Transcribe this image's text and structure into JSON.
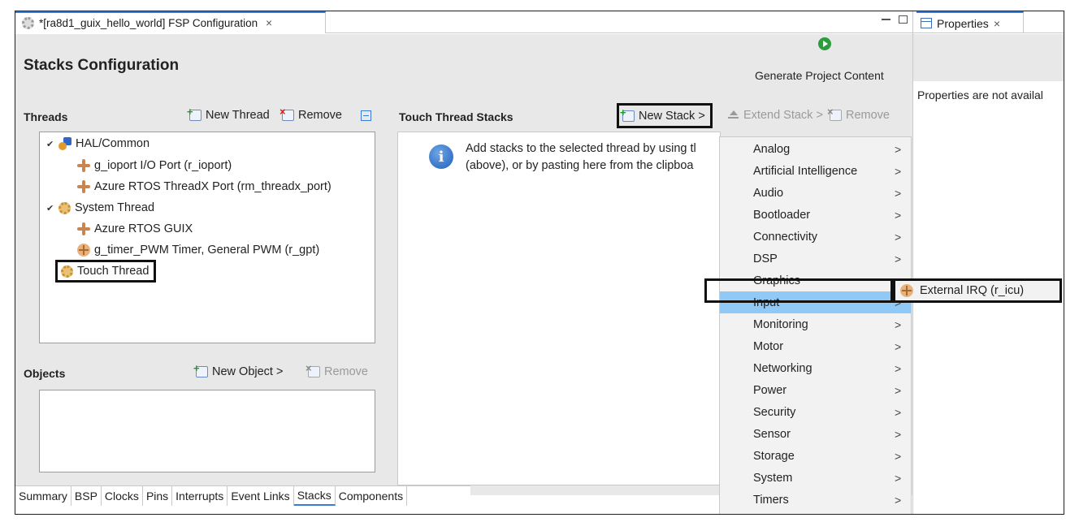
{
  "editor_tab": {
    "title": "*[ra8d1_guix_hello_world] FSP Configuration",
    "close": "×"
  },
  "stacks_header": {
    "title": "Stacks Configuration",
    "generate_label": "Generate Project Content"
  },
  "threads": {
    "title": "Threads",
    "new_thread": "New Thread",
    "remove": "Remove",
    "tree": [
      {
        "label": "HAL/Common",
        "icon": "hal-icon"
      },
      {
        "label": "g_ioport I/O Port (r_ioport)",
        "icon": "module-icon"
      },
      {
        "label": "Azure RTOS ThreadX Port (rm_threadx_port)",
        "icon": "module-icon"
      },
      {
        "label": "System Thread",
        "icon": "gear-icon"
      },
      {
        "label": "Azure RTOS GUIX",
        "icon": "module-icon"
      },
      {
        "label": "g_timer_PWM Timer, General PWM (r_gpt)",
        "icon": "module-icon"
      },
      {
        "label": "Touch Thread",
        "icon": "gear-icon"
      }
    ]
  },
  "objects": {
    "title": "Objects",
    "new_object": "New Object >",
    "remove": "Remove"
  },
  "touch_stacks": {
    "title": "Touch Thread Stacks",
    "new_stack": "New Stack >",
    "extend_stack": "Extend Stack >",
    "remove": "Remove",
    "info_line1": "Add stacks to the selected thread by using tl",
    "info_line2": "(above), or by pasting here from the clipboa"
  },
  "menu": {
    "items": [
      {
        "label": "Analog",
        "arrow": ">"
      },
      {
        "label": "Artificial Intelligence",
        "arrow": ">"
      },
      {
        "label": "Audio",
        "arrow": ">"
      },
      {
        "label": "Bootloader",
        "arrow": ">"
      },
      {
        "label": "Connectivity",
        "arrow": ">"
      },
      {
        "label": "DSP",
        "arrow": ">"
      },
      {
        "label": "Graphics",
        "arrow": ">"
      },
      {
        "label": "Input",
        "arrow": ">"
      },
      {
        "label": "Monitoring",
        "arrow": ">"
      },
      {
        "label": "Motor",
        "arrow": ">"
      },
      {
        "label": "Networking",
        "arrow": ">"
      },
      {
        "label": "Power",
        "arrow": ">"
      },
      {
        "label": "Security",
        "arrow": ">"
      },
      {
        "label": "Sensor",
        "arrow": ">"
      },
      {
        "label": "Storage",
        "arrow": ">"
      },
      {
        "label": "System",
        "arrow": ">"
      },
      {
        "label": "Timers",
        "arrow": ">"
      }
    ],
    "selected_index": 7
  },
  "submenu": {
    "label": "External IRQ (r_icu)"
  },
  "bottom_tabs": [
    "Summary",
    "BSP",
    "Clocks",
    "Pins",
    "Interrupts",
    "Event Links",
    "Stacks",
    "Components"
  ],
  "active_bottom_tab": "Stacks",
  "properties": {
    "tab_title": "Properties",
    "close": "×",
    "message": "Properties are not availal"
  },
  "colors": {
    "selection": "#90c8f6",
    "accent": "#3a7bd5",
    "panel_grey": "#e8e8e8"
  }
}
